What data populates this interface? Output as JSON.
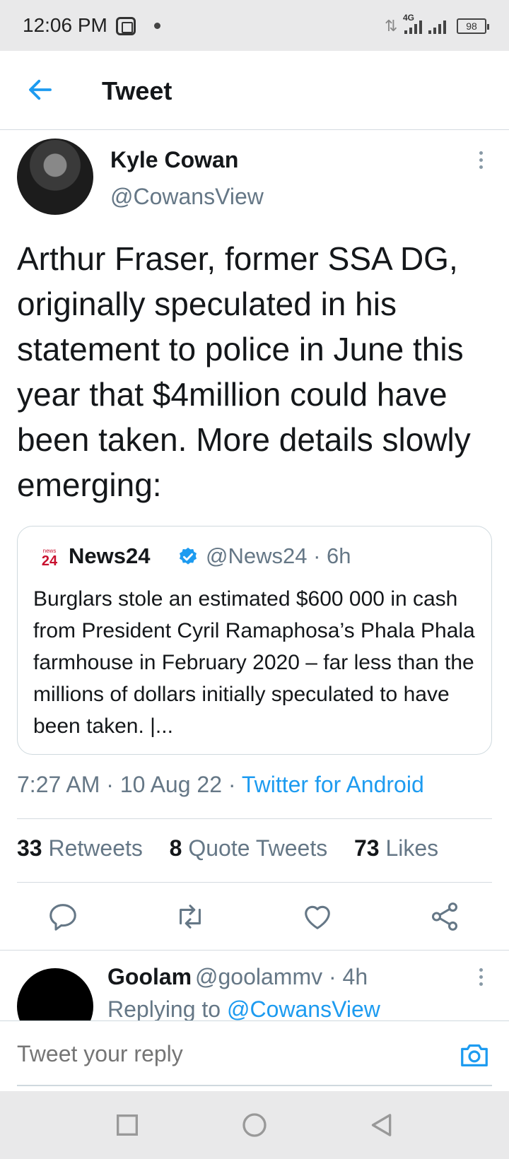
{
  "status_bar": {
    "time": "12:06 PM",
    "network": "4G",
    "battery": "98"
  },
  "header": {
    "title": "Tweet"
  },
  "tweet": {
    "author_name": "Kyle Cowan",
    "author_handle": "@CowansView",
    "text": "Arthur Fraser, former SSA DG, originally speculated in his statement to police in June this year that $4million could have been taken. More details slowly emerging:",
    "quote": {
      "logo_small": "news",
      "logo_big": "24",
      "name": "News24",
      "handle_time": "@News24 · 6h",
      "text": "Burglars stole an estimated $600 000 in cash from President Cyril Ramaphosa’s Phala Phala farmhouse in February 2020 – far less than the millions of dollars initially speculated to have been taken. |..."
    },
    "meta_time": "7:27 AM · 10 Aug 22 · ",
    "meta_source": "Twitter for Android",
    "stats": {
      "retweets_count": "33",
      "retweets_label": "Retweets",
      "quotes_count": "8",
      "quotes_label": "Quote Tweets",
      "likes_count": "73",
      "likes_label": "Likes"
    }
  },
  "reply": {
    "name": "Goolam",
    "handle_time": "@goolammv · 4h",
    "replying_prefix": "Replying to ",
    "replying_mention": "@CowansView"
  },
  "compose": {
    "placeholder": "Tweet your reply"
  },
  "colors": {
    "accent": "#1d9bf0",
    "muted": "#657786",
    "news24_red": "#c8102e"
  }
}
